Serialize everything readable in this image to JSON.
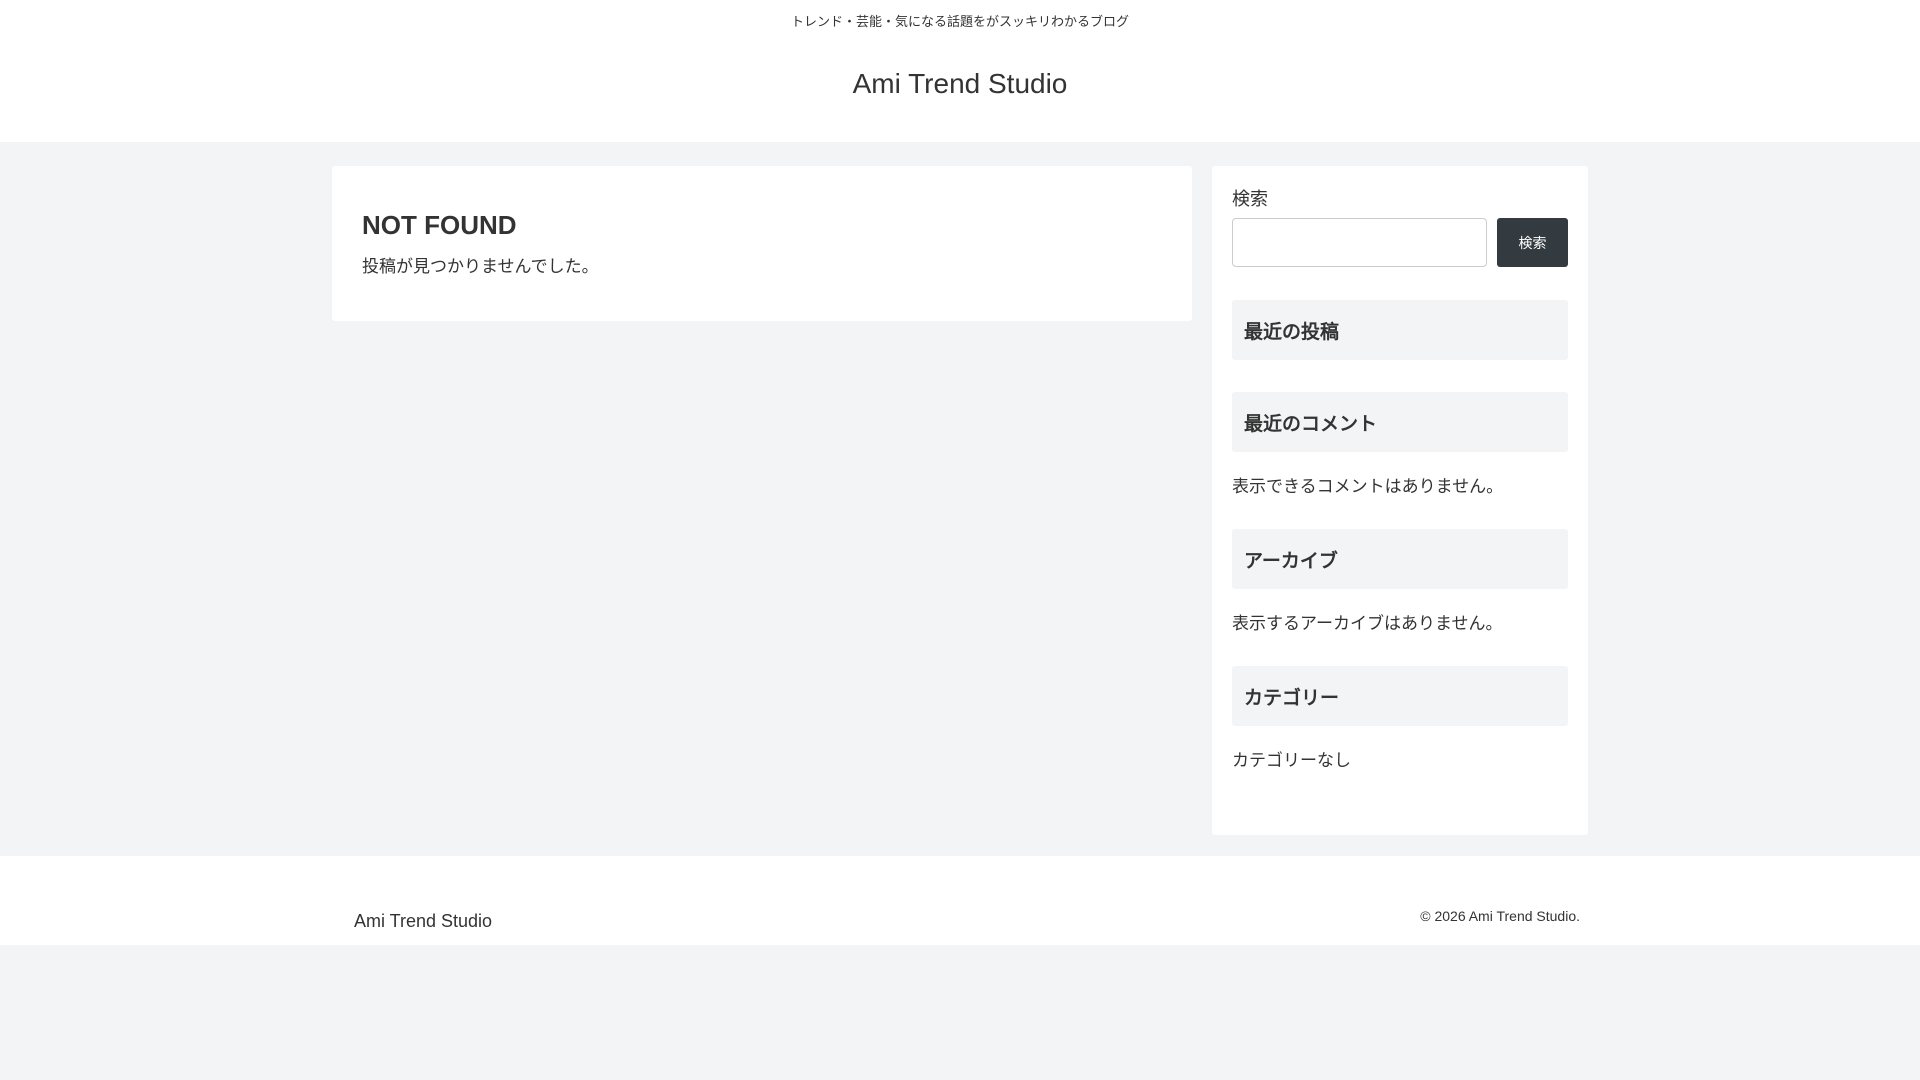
{
  "header": {
    "tagline": "トレンド・芸能・気になる話題をがスッキリわかるブログ",
    "title": "Ami Trend Studio"
  },
  "main": {
    "heading": "NOT FOUND",
    "message": "投稿が見つかりませんでした。"
  },
  "sidebar": {
    "search": {
      "label": "検索",
      "placeholder": "",
      "button": "検索"
    },
    "widgets": [
      {
        "title": "最近の投稿",
        "text": ""
      },
      {
        "title": "最近のコメント",
        "text": "表示できるコメントはありません。"
      },
      {
        "title": "アーカイブ",
        "text": "表示するアーカイブはありません。"
      },
      {
        "title": "カテゴリー",
        "text": "カテゴリーなし"
      }
    ]
  },
  "footer": {
    "site_name": "Ami Trend Studio",
    "copyright": "© 2026 Ami Trend Studio."
  }
}
